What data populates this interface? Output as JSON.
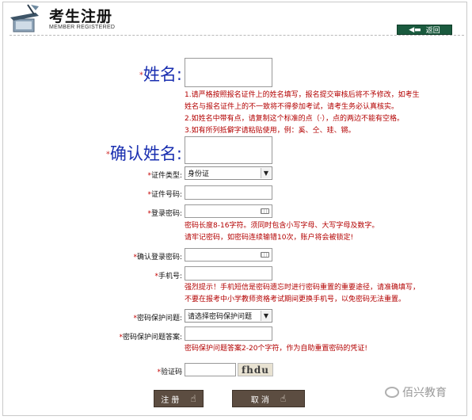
{
  "header": {
    "title": "考生注册",
    "subtitle": "MEMBER REGISTERED",
    "back_label": "返回"
  },
  "form": {
    "name_label": "姓名:",
    "name_notes": [
      "1.请严格按照报名证件上的姓名填写，报名提交审核后将不予修改，如考生",
      "姓名与报名证件上的不一致将不得参加考试，请考生务必认真核实。",
      "2.如姓名中带有点，请复制这个标准的点（·），点的两边不能有空格。",
      "3.如有所列抵僻字请粘贴使用，例：奚、仝、珪、锵。"
    ],
    "confirm_name_label": "确认姓名:",
    "id_type_label": "证件类型:",
    "id_type_value": "身份证",
    "id_number_label": "证件号码:",
    "password_label": "登录密码:",
    "password_notes": [
      "密码长度8-16字符。须同时包含小写字母、大写字母及数字。",
      "请牢记密码，如密码连续输错10次，账户将会被锁定!"
    ],
    "confirm_password_label": "确认登录密码:",
    "phone_label": "手机号:",
    "phone_notes": [
      "强烈提示！手机短信是密码遗忘时进行密码重置的重要途径，请准确填写，",
      "不要在报考中小学教师资格考试期间更换手机号，以免密码无法重置。"
    ],
    "question_label": "密码保护问题:",
    "question_value": "请选择密码保护问题",
    "answer_label": "密码保护问题答案:",
    "answer_note": "密码保护问题答案2-20个字符，作为自助重置密码的凭证!",
    "captcha_label": "验证码",
    "captcha_text": "fhdu",
    "required_mark": "*"
  },
  "buttons": {
    "submit_label": "注 册",
    "cancel_label": "取 消"
  },
  "watermark": "佰兴教育",
  "colors": {
    "note_red": "#b30000",
    "big_label_blue": "#1a2fb0",
    "button_brown": "#5c4d41",
    "back_green": "#1a5a3e"
  }
}
